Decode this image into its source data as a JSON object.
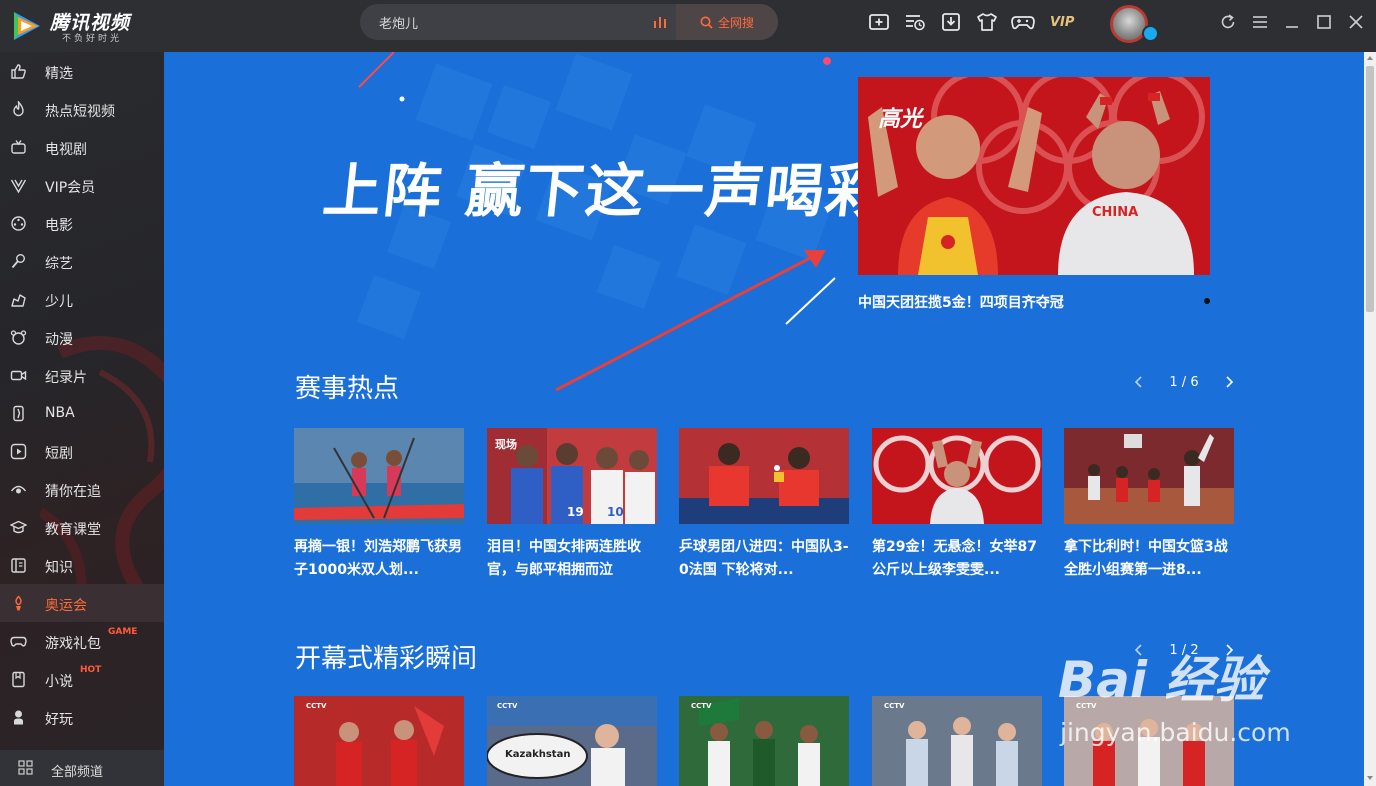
{
  "app": {
    "logo_title": "腾讯视频",
    "logo_subtitle": "不负好时光"
  },
  "search": {
    "value": "老炮儿",
    "button_label": "全网搜"
  },
  "toolbar": {
    "vip_label": "VIP"
  },
  "sidebar": {
    "items": [
      {
        "label": "精选",
        "icon": "thumbs-up-icon"
      },
      {
        "label": "热点短视频",
        "icon": "flame-icon"
      },
      {
        "label": "电视剧",
        "icon": "tv-icon"
      },
      {
        "label": "VIP会员",
        "icon": "vip-v-icon"
      },
      {
        "label": "电影",
        "icon": "film-reel-icon"
      },
      {
        "label": "综艺",
        "icon": "microphone-icon"
      },
      {
        "label": "少儿",
        "icon": "kids-icon"
      },
      {
        "label": "动漫",
        "icon": "bear-face-icon"
      },
      {
        "label": "纪录片",
        "icon": "camera-icon"
      },
      {
        "label": "NBA",
        "icon": "nba-icon"
      },
      {
        "label": "短剧",
        "icon": "play-circle-icon"
      },
      {
        "label": "猜你在追",
        "icon": "eye-icon"
      },
      {
        "label": "教育课堂",
        "icon": "graduation-cap-icon"
      },
      {
        "label": "知识",
        "icon": "book-icon"
      },
      {
        "label": "奥运会",
        "icon": "torch-icon"
      },
      {
        "label": "游戏礼包",
        "icon": "gamepad-icon",
        "tag": "GAME"
      },
      {
        "label": "小说",
        "icon": "novel-icon",
        "tag": "HOT"
      },
      {
        "label": "好玩",
        "icon": "person-icon"
      }
    ],
    "active_index": 14,
    "all_channels_label": "全部频道"
  },
  "banner": {
    "slogan": "上阵 赢下这一声喝彩",
    "card_tag": "高光",
    "caption": "中国天团狂揽5金！四项目齐夺冠",
    "jersey_text": "CHINA"
  },
  "sections": [
    {
      "title": "赛事热点",
      "pager": "1 / 6",
      "cards": [
        {
          "title": "再摘一银！刘浩郑鹏飞获男子1000米双人划..."
        },
        {
          "title": "泪目！中国女排两连胜收官，与郎平相拥而泣",
          "tag": "现场"
        },
        {
          "title": "乒球男团八进四：中国队3-0法国 下轮将对..."
        },
        {
          "title": "第29金！无悬念！女举87公斤以上级李雯雯..."
        },
        {
          "title": "拿下比利时！中国女篮3战全胜小组赛第一进8..."
        }
      ]
    },
    {
      "title": "开幕式精彩瞬间",
      "pager": "1 / 2",
      "cards": [
        {
          "badge": "CCTV"
        },
        {
          "badge": "CCTV",
          "sign": "Kazakhstan"
        },
        {
          "badge": "CCTV"
        },
        {
          "badge": "CCTV"
        },
        {
          "badge": "CCTV"
        }
      ]
    }
  ],
  "watermark": {
    "brand": "Bai 经验",
    "url": "jingyan.baidu.com"
  },
  "colors": {
    "accent": "#ff6a3c",
    "main_bg": "#1a6fd8",
    "topbar": "#2e2f33",
    "vip_gold": "#e6c27a"
  }
}
